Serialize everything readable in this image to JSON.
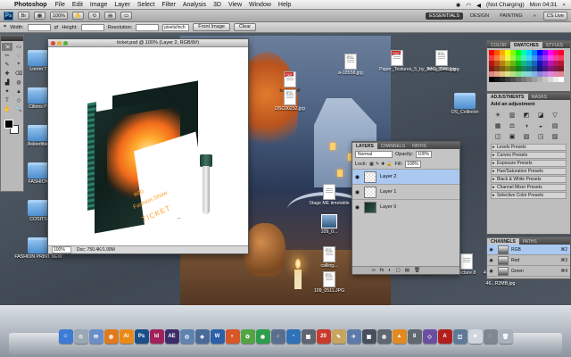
{
  "menubar": {
    "app_name": "Photoshop",
    "items": [
      "File",
      "Edit",
      "Image",
      "Layer",
      "Select",
      "Filter",
      "Analysis",
      "3D",
      "View",
      "Window",
      "Help"
    ],
    "battery": "(Not Charging)",
    "clock": "Mon 04:31"
  },
  "appbar": {
    "ps_label": "Ps",
    "zoom": "100%",
    "workspaces": [
      "ESSENTIALS",
      "DESIGN",
      "PAINTING"
    ],
    "more": "»",
    "cs_live": "CS Live"
  },
  "options": {
    "width_label": "Width:",
    "height_label": "Height:",
    "resolution_label": "Resolution:",
    "res_unit": "pixels/inch",
    "front_image": "Front Image",
    "clear": "Clear"
  },
  "document": {
    "title": "ticket.psd @ 100% (Layer 2, RGB/8#)",
    "zoom": "100%",
    "doc_size": "Doc: 750.4K/1.99M",
    "ticket_line1": "eco",
    "ticket_line2": "Fashion Show",
    "ticket_line3": "TICKET"
  },
  "desktop_icons": [
    {
      "label": "Lorem T",
      "kind": "folder",
      "name": "folder-lorem"
    },
    {
      "label": "Cilions Pl",
      "kind": "folder",
      "name": "folder-cilions"
    },
    {
      "label": "Asleeditan",
      "kind": "folder",
      "name": "folder-asleeditan"
    },
    {
      "label": "FASHION",
      "kind": "folder",
      "name": "folder-fashion"
    },
    {
      "label": "COSITS",
      "kind": "folder",
      "name": "folder-cosits"
    },
    {
      "label": "FASHION PRINT NEW",
      "kind": "folder",
      "name": "folder-fashion-print-new"
    },
    {
      "label": "badge.pdf",
      "kind": "pdf",
      "name": "file-badge-pdf"
    },
    {
      "label": "DSC00232.jpg",
      "kind": "jpg",
      "name": "file-dsc00232"
    },
    {
      "label": "Stage ME timetable",
      "kind": "jpg",
      "name": "file-stage-timetable"
    },
    {
      "label": "109_0...",
      "kind": "jpg",
      "name": "file-109-0"
    },
    {
      "label": "calling...",
      "kind": "jpg",
      "name": "file-calling"
    },
    {
      "label": "109_0511.JPG",
      "kind": "jpg",
      "name": "file-109-0511"
    },
    {
      "label": "a-18558.jpg",
      "kind": "jpg",
      "name": "file-a-18558"
    },
    {
      "label": "Paper_Textures_5_by_linmy_Stock.jpg",
      "kind": "jpg",
      "name": "file-paper-textures"
    },
    {
      "label": "IMG_8046.jpg",
      "kind": "jpg",
      "name": "file-img-8046"
    },
    {
      "label": "photoshop.pdf",
      "kind": "pdf",
      "name": "file-photoshop-pdf"
    },
    {
      "label": "Picture 8",
      "kind": "jpg",
      "name": "file-picture-8"
    },
    {
      "label": "40298298-1972-FNBP-46...R2MB.jpg",
      "kind": "jpg",
      "name": "file-40298298"
    },
    {
      "label": "OS_Collector",
      "kind": "folder",
      "name": "folder-os-collector"
    }
  ],
  "layers_panel": {
    "tabs": [
      "LAYERS",
      "CHANNELS",
      "PATHS"
    ],
    "blend_mode": "Normal",
    "opacity_label": "Opacity:",
    "opacity": "100%",
    "lock_label": "Lock:",
    "fill_label": "Fill:",
    "fill": "100%",
    "layers": [
      {
        "name": "Layer 2",
        "active": true
      },
      {
        "name": "Layer 1",
        "active": false
      },
      {
        "name": "Layer 0",
        "active": false
      }
    ],
    "footer_icons": [
      "∞",
      "fx",
      "◐",
      "▢",
      "▤",
      "🗑"
    ]
  },
  "color_panel": {
    "tabs": [
      "COLOR",
      "SWATCHES",
      "STYLES"
    ]
  },
  "adjustments_panel": {
    "tabs": [
      "ADJUSTMENTS",
      "MASKS"
    ],
    "title": "Add an adjustment",
    "icons": [
      "☀",
      "▥",
      "◩",
      "◪",
      "▽",
      "▦",
      "⚖",
      "◑",
      "◒",
      "▤",
      "◫",
      "▣",
      "▧",
      "◳",
      "▨"
    ],
    "presets": [
      "Levels Presets",
      "Curves Presets",
      "Exposure Presets",
      "Hue/Saturation Presets",
      "Black & White Presets",
      "Channel Mixer Presets",
      "Selective Color Presets"
    ]
  },
  "channels_panel": {
    "tabs": [
      "CHANNELS",
      "PATHS"
    ],
    "channels": [
      {
        "name": "RGB",
        "key": "⌘2",
        "active": true
      },
      {
        "name": "Red",
        "key": "⌘3",
        "active": false
      },
      {
        "name": "Green",
        "key": "⌘4",
        "active": false
      }
    ]
  },
  "tools": [
    "⇲",
    "▭",
    "✂",
    "◌",
    "✎",
    "⌖",
    "✚",
    "⌫",
    "▟",
    "◍",
    "✦",
    "▲",
    "T",
    "◇",
    "✋",
    "🔍"
  ],
  "dock": {
    "icons": [
      {
        "label": "☺",
        "color": "#3d7bd6",
        "name": "finder-icon"
      },
      {
        "label": "⊙",
        "color": "#9aa7b4",
        "name": "dashboard-icon"
      },
      {
        "label": "✉",
        "color": "#6a8fc7",
        "name": "mail-icon"
      },
      {
        "label": "◍",
        "color": "#e07a1f",
        "name": "firefox-icon"
      },
      {
        "label": "Ai",
        "color": "#e88a1a",
        "name": "illustrator-icon"
      },
      {
        "label": "Ps",
        "color": "#1b4f88",
        "name": "photoshop-dock-icon"
      },
      {
        "label": "Id",
        "color": "#a0225a",
        "name": "indesign-icon"
      },
      {
        "label": "AE",
        "color": "#3b2c6b",
        "name": "aftereffects-icon"
      },
      {
        "label": "◎",
        "color": "#5f82b1",
        "name": "ichat-icon"
      },
      {
        "label": "◈",
        "color": "#4a6a98",
        "name": "photo-booth-icon"
      },
      {
        "label": "W",
        "color": "#2b5fa8",
        "name": "word-icon"
      },
      {
        "label": "◐",
        "color": "#d7562a",
        "name": "pages-icon"
      },
      {
        "label": "✿",
        "color": "#53a544",
        "name": "itunes-icon"
      },
      {
        "label": "◉",
        "color": "#2f9e4c",
        "name": "spotify-icon"
      },
      {
        "label": "♪",
        "color": "#5a6f8e",
        "name": "music-icon"
      },
      {
        "label": "◔",
        "color": "#2d72b8",
        "name": "skype-icon"
      },
      {
        "label": "▦",
        "color": "#5e6570",
        "name": "grid-icon"
      },
      {
        "label": "20",
        "color": "#c93a2b",
        "name": "calendar-icon"
      },
      {
        "label": "✎",
        "color": "#c7a55f",
        "name": "textedit-icon"
      },
      {
        "label": "✈",
        "color": "#5d7ba8",
        "name": "mail-stamp-icon"
      },
      {
        "label": "▣",
        "color": "#45505c",
        "name": "terminal-icon"
      },
      {
        "label": "◍",
        "color": "#60676f",
        "name": "system-prefs-icon"
      },
      {
        "label": "▲",
        "color": "#e28a20",
        "name": "vlc-icon"
      },
      {
        "label": "8",
        "color": "#606870",
        "name": "unarchiver-icon"
      },
      {
        "label": "◇",
        "color": "#6a4fa0",
        "name": "app-icon"
      },
      {
        "label": "A",
        "color": "#b21f1f",
        "name": "acrobat-icon"
      },
      {
        "label": "◫",
        "color": "#5d7a99",
        "name": "preview-icon"
      },
      {
        "label": "☻",
        "color": "#cfd6de",
        "name": "downloads-icon"
      },
      {
        "label": "◌",
        "color": "#7e8792",
        "name": "documents-icon"
      },
      {
        "label": "🗑",
        "color": "#a9b1ba",
        "name": "trash-icon"
      }
    ]
  }
}
